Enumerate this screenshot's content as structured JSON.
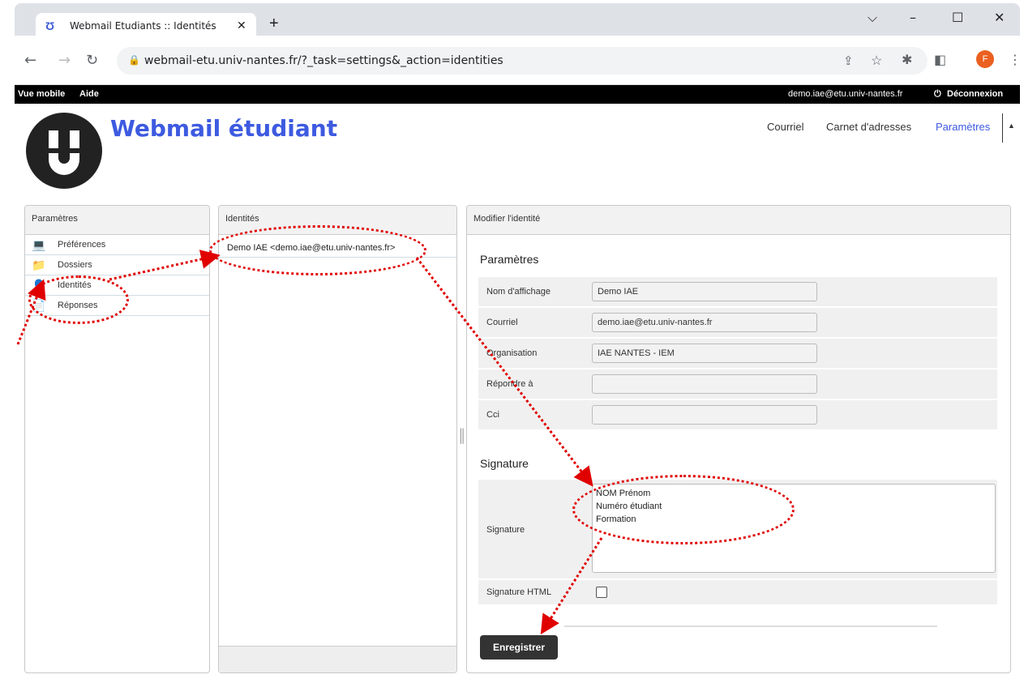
{
  "browser": {
    "tab_title": "Webmail Etudiants :: Identités",
    "url": "webmail-etu.univ-nantes.fr/?_task=settings&_action=identities",
    "avatar_letter": "F"
  },
  "topbar": {
    "mobile_view": "Vue mobile",
    "help": "Aide",
    "user_email": "demo.iae@etu.univ-nantes.fr",
    "logout": "Déconnexion"
  },
  "header": {
    "app_title": "Webmail étudiant",
    "nav": [
      "Courriel",
      "Carnet d'adresses",
      "Paramètres"
    ]
  },
  "settings_panel": {
    "title": "Paramètres",
    "items": [
      {
        "label": "Préférences",
        "icon": "monitor-icon"
      },
      {
        "label": "Dossiers",
        "icon": "folder-icon"
      },
      {
        "label": "Identités",
        "icon": "user-icon"
      },
      {
        "label": "Réponses",
        "icon": "document-icon"
      }
    ]
  },
  "identities_panel": {
    "title": "Identités",
    "items": [
      "Demo IAE <demo.iae@etu.univ-nantes.fr>"
    ]
  },
  "edit_panel": {
    "title": "Modifier l'identité",
    "section_settings": "Paramètres",
    "fields": [
      {
        "label": "Nom d'affichage",
        "value": "Demo IAE"
      },
      {
        "label": "Courriel",
        "value": "demo.iae@etu.univ-nantes.fr"
      },
      {
        "label": "Organisation",
        "value": "IAE NANTES - IEM"
      },
      {
        "label": "Répondre à",
        "value": ""
      },
      {
        "label": "Cci",
        "value": ""
      }
    ],
    "section_signature": "Signature",
    "signature_label": "Signature",
    "signature_value": "NOM Prénom\nNuméro étudiant\nFormation",
    "html_signature_label": "Signature HTML",
    "save_button": "Enregistrer"
  },
  "colors": {
    "accent": "#3d5ae0",
    "annotation": "#e00000"
  }
}
